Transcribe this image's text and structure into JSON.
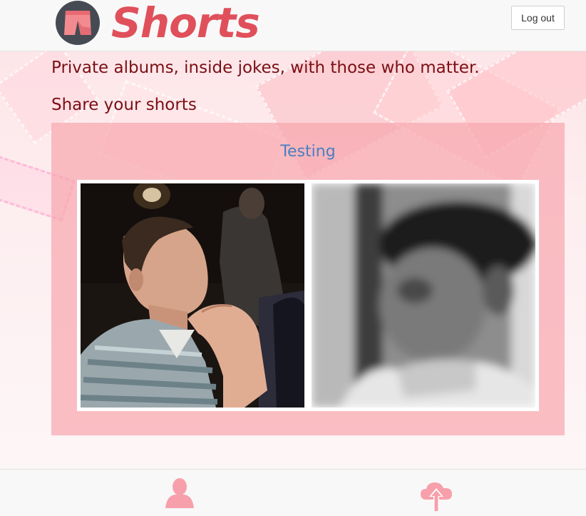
{
  "header": {
    "brand": "Shorts",
    "logo_icon": "shorts-logo-icon",
    "logout_label": "Log out"
  },
  "main": {
    "tagline": "Private albums, inside jokes, with those who matter.",
    "share_heading": "Share your shorts",
    "album": {
      "title": "Testing",
      "photos": [
        {
          "description_icon": "photo-man-looking-right"
        },
        {
          "description_icon": "photo-blurred-grayscale-portrait"
        }
      ]
    }
  },
  "footer": {
    "profile_icon": "user-icon",
    "upload_icon": "cloud-upload-icon"
  },
  "colors": {
    "brand": "#e0505b",
    "panel": "#f6a8ae",
    "text_dark": "#7a0f15",
    "link": "#4a7fc2",
    "footer_icon": "#f7a0ab"
  }
}
